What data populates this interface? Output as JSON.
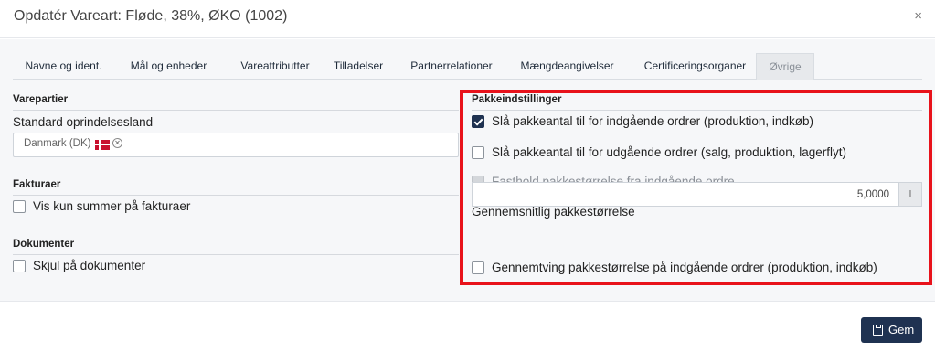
{
  "dialog": {
    "title": "Opdatér Vareart: Fløde, 38%, ØKO (1002)",
    "close_glyph": "×"
  },
  "tabs": [
    {
      "label": "Navne og ident.",
      "active": false
    },
    {
      "label": "Mål og enheder",
      "active": false
    },
    {
      "label": "Vareattributter",
      "active": false
    },
    {
      "label": "Tilladelser",
      "active": false
    },
    {
      "label": "Partnerrelationer",
      "active": false
    },
    {
      "label": "Mængdeangivelser",
      "active": false
    },
    {
      "label": "Certificeringsorganer",
      "active": false
    },
    {
      "label": "Øvrige",
      "active": true
    }
  ],
  "varepartier": {
    "title": "Varepartier",
    "origin_label": "Standard oprindelsesland",
    "origin_tag": "Danmark (DK)",
    "remove_glyph": "✕"
  },
  "fakturaer": {
    "title": "Fakturaer",
    "option": {
      "label": "Vis kun summer på fakturaer",
      "checked": false
    }
  },
  "dokumenter": {
    "title": "Dokumenter",
    "option": {
      "label": "Skjul på dokumenter",
      "checked": false
    }
  },
  "pakke": {
    "title": "Pakkeindstillinger",
    "options": [
      {
        "label": "Slå pakkeantal til for indgående ordrer (produktion, indkøb)",
        "checked": true,
        "disabled": false
      },
      {
        "label": "Slå pakkeantal til for udgående ordrer (salg, produktion, lagerflyt)",
        "checked": false,
        "disabled": false
      },
      {
        "label": "Fasthold pakkestørrelse fra indgående ordre",
        "checked": false,
        "disabled": true
      }
    ],
    "avg_size_label": "Gennemsnitlig pakkestørrelse",
    "avg_size_value": "5,0000",
    "avg_size_unit": "l",
    "enforce_option": {
      "label": "Gennemtving pakkestørrelse på indgående ordrer (produktion, indkøb)",
      "checked": false
    }
  },
  "footer": {
    "save_label": "Gem"
  },
  "colors": {
    "primary": "#1f3251",
    "highlight": "#e8121b",
    "flag_red": "#c8102e"
  }
}
